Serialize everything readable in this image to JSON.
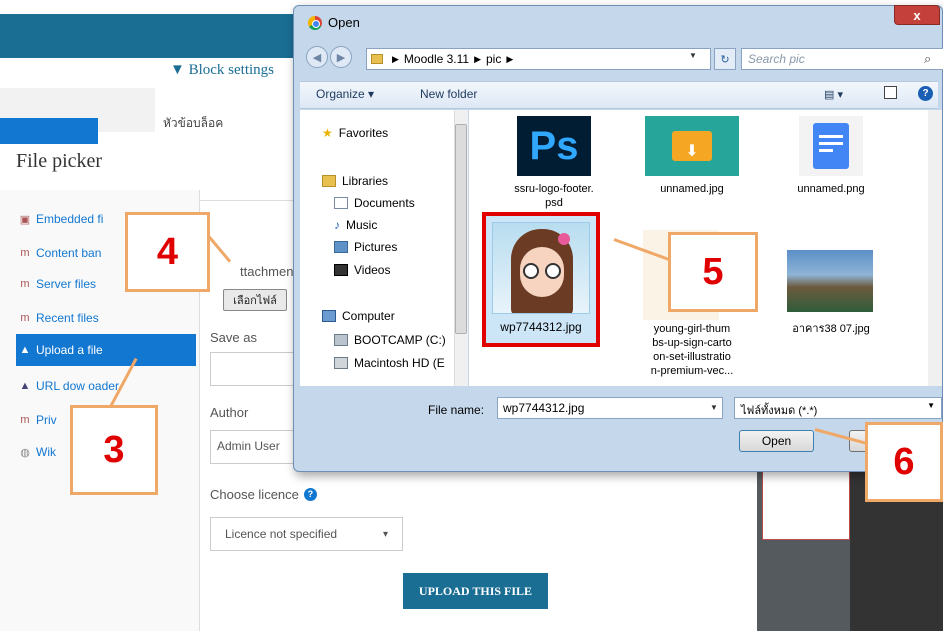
{
  "moodle": {
    "block_settings": "▼ Block settings",
    "block_heading": "หัวข้อบล็อค"
  },
  "file_picker": {
    "title": "File picker",
    "repositories": [
      {
        "label": "Embedded fi",
        "icon": "embedded-files-icon"
      },
      {
        "label": "Content ban",
        "icon": "content-bank-icon"
      },
      {
        "label": "Server files",
        "icon": "server-files-icon"
      },
      {
        "label": "Recent files",
        "icon": "recent-files-icon"
      },
      {
        "label": "Upload a file",
        "icon": "upload-icon"
      },
      {
        "label": "URL dow  oader",
        "icon": "url-downloader-icon"
      },
      {
        "label": "Priv",
        "icon": "private-files-icon"
      },
      {
        "label": "Wik",
        "icon": "wikimedia-icon"
      }
    ],
    "active_repository": "Upload a file",
    "attachment_label": "ttachment",
    "browse_button": "เลือกไฟล์",
    "saveas_label": "Save as",
    "saveas_value": "",
    "author_label": "Author",
    "author_value": "Admin User",
    "licence_label": "Choose licence",
    "licence_value": "Licence not specified",
    "upload_button": "UPLOAD THIS FILE"
  },
  "open_dialog": {
    "title": "Open",
    "close_glyph": "x",
    "breadcrumb": [
      "Moodle 3.11",
      "pic"
    ],
    "search_placeholder": "Search pic",
    "toolbar": {
      "organize": "Organize ▾",
      "new_folder": "New folder",
      "view": "▤ ▾"
    },
    "nav": {
      "favorites": "Favorites",
      "libraries": "Libraries",
      "documents": "Documents",
      "music": "Music",
      "pictures": "Pictures",
      "videos": "Videos",
      "computer": "Computer",
      "bootcamp": "BOOTCAMP (C:)",
      "macintosh": "Macintosh HD (E"
    },
    "files": [
      {
        "name": "ssru-logo-footer.\npsd",
        "kind": "photoshop"
      },
      {
        "name": "unnamed.jpg",
        "kind": "folder-download"
      },
      {
        "name": "unnamed.png",
        "kind": "google-doc"
      },
      {
        "name": "wp7744312.jpg",
        "kind": "cartoon-girl",
        "selected": true
      },
      {
        "name": "young-girl-thum\nbs-up-sign-carto\non-set-illustratio\nn-premium-vec...",
        "kind": "illustration"
      },
      {
        "name": "อาคาร38 07.jpg",
        "kind": "building-photo"
      }
    ],
    "filename_label": "File name:",
    "filename_value": "wp7744312.jpg",
    "filetype_value": "ไฟล์ทั้งหมด (*.*)",
    "open_button": "Open"
  },
  "callouts": [
    "3",
    "4",
    "5",
    "6"
  ],
  "colors": {
    "moodle_blue": "#1a6e94",
    "active_blue": "#1177d1",
    "callout_border": "#f0a868",
    "callout_text": "#e00000",
    "selection_red": "#e00000"
  }
}
